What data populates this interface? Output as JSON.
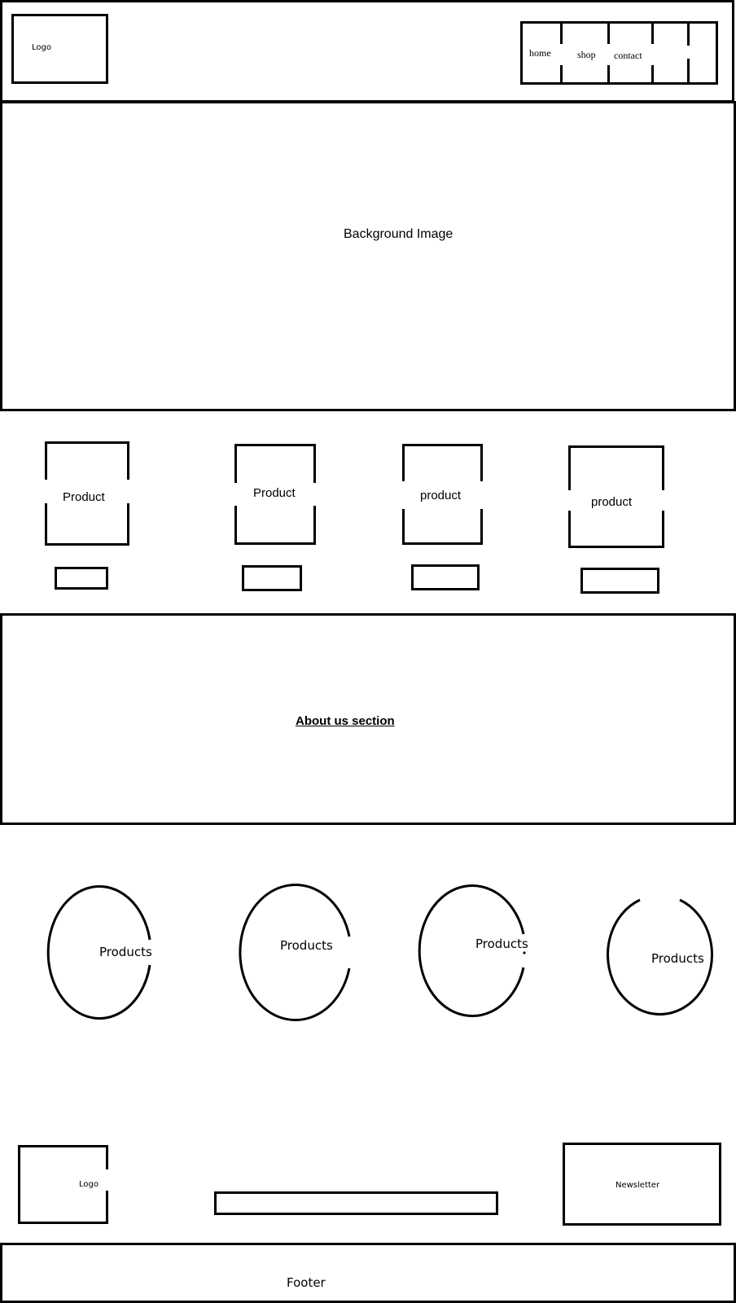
{
  "header": {
    "logo_label": "Logo",
    "nav": {
      "items": [
        {
          "label": "home"
        },
        {
          "label": "shop"
        },
        {
          "label": "contact"
        },
        {
          "label": ""
        },
        {
          "label": ""
        }
      ]
    }
  },
  "hero": {
    "label": "Background Image"
  },
  "product_cards": [
    {
      "label": "Product"
    },
    {
      "label": "Product"
    },
    {
      "label": "product"
    },
    {
      "label": "product"
    }
  ],
  "about": {
    "label": "About us section"
  },
  "product_circles": [
    {
      "label": "Products"
    },
    {
      "label": "Products"
    },
    {
      "label": "Products"
    },
    {
      "label": "Products"
    }
  ],
  "footer_top": {
    "logo_label": "Logo",
    "newsletter_label": "Newsletter"
  },
  "footer": {
    "label": "Footer"
  }
}
